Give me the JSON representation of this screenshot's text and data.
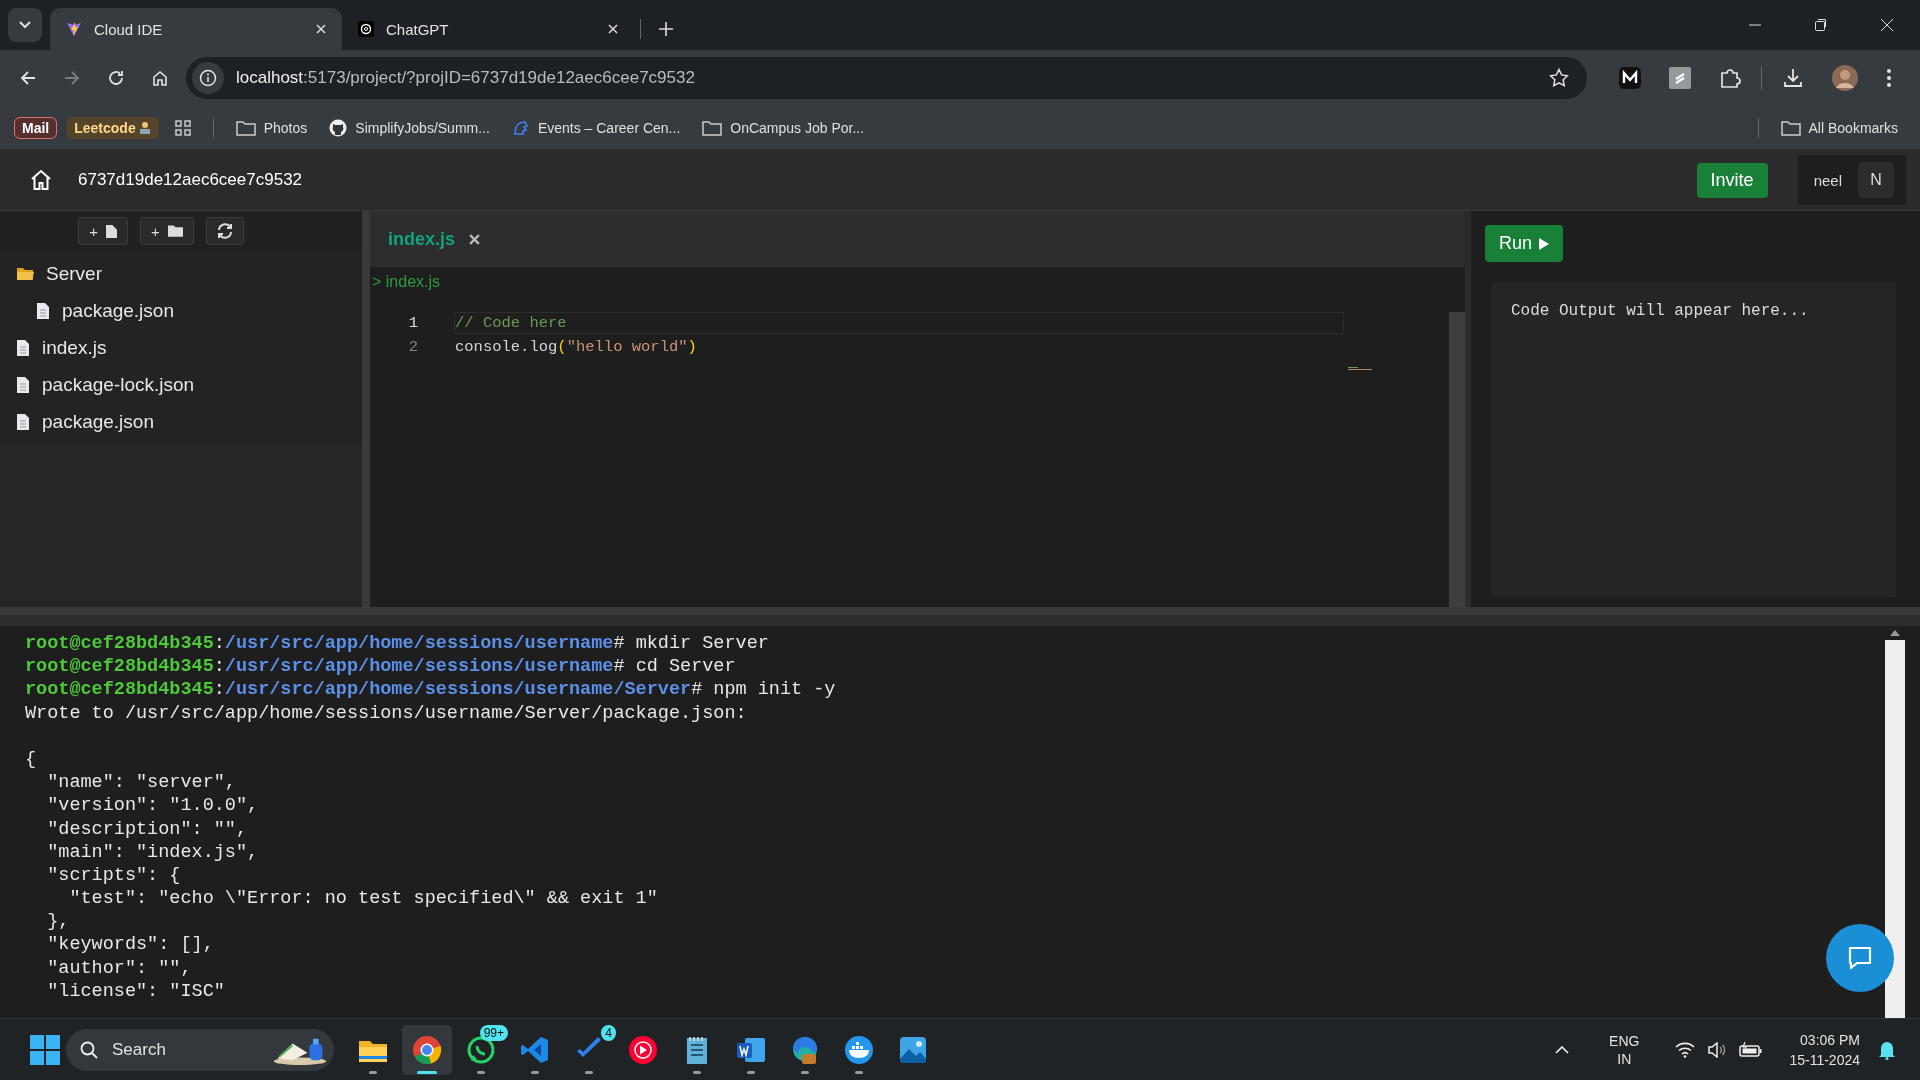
{
  "browser": {
    "tabs": [
      {
        "title": "Cloud IDE",
        "kind": "vite",
        "selected": true
      },
      {
        "title": "ChatGPT",
        "kind": "chatgpt",
        "selected": false
      }
    ],
    "url": {
      "host": "localhost",
      "rest": ":5173/project/?projID=6737d19de12aec6cee7c9532"
    },
    "bookmarks": [
      {
        "label": "Mail",
        "kind": "mail"
      },
      {
        "label": "Leetcode",
        "kind": "leetcode"
      },
      {
        "kind": "apps"
      },
      {
        "label": "Photos",
        "kind": "folder"
      },
      {
        "label": "SimplifyJobs/Summ...",
        "kind": "github"
      },
      {
        "label": "Events – Career Cen...",
        "kind": "events"
      },
      {
        "label": "OnCampus Job Por...",
        "kind": "folder"
      }
    ],
    "all_bookmarks": "All Bookmarks"
  },
  "app": {
    "project_id": "6737d19de12aec6cee7c9532",
    "invite": "Invite",
    "user": {
      "name": "neel",
      "initial": "N"
    },
    "explorer_buttons": [
      {
        "label": "+",
        "kind": "file"
      },
      {
        "label": "+",
        "kind": "folder"
      },
      {
        "kind": "refresh"
      }
    ],
    "tree": [
      {
        "name": "Server",
        "kind": "folder",
        "children": [
          {
            "name": "package.json",
            "kind": "file"
          }
        ]
      },
      {
        "name": "index.js",
        "kind": "file"
      },
      {
        "name": "package-lock.json",
        "kind": "file"
      },
      {
        "name": "package.json",
        "kind": "file"
      }
    ],
    "editor": {
      "tab": "index.js",
      "breadcrumb": "> index.js",
      "lines": [
        {
          "number": "1",
          "current": true,
          "tokens": [
            {
              "text": "// Code here",
              "kind": "comment"
            }
          ]
        },
        {
          "number": "2",
          "current": false,
          "tokens": [
            {
              "text": "console.log",
              "kind": "plain"
            },
            {
              "text": "(",
              "kind": "bracket"
            },
            {
              "text": "\"hello world\"",
              "kind": "string"
            },
            {
              "text": ")",
              "kind": "bracket"
            }
          ]
        }
      ]
    },
    "run": "Run",
    "output_placeholder": "Code Output will appear here...",
    "terminal": [
      {
        "kind": "prompt",
        "user": "root@cef28bd4b345",
        "sep": ":",
        "path": "/usr/src/app/home/sessions/username",
        "command": "# mkdir Server"
      },
      {
        "kind": "prompt",
        "user": "root@cef28bd4b345",
        "sep": ":",
        "path": "/usr/src/app/home/sessions/username",
        "command": "# cd Server"
      },
      {
        "kind": "prompt",
        "user": "root@cef28bd4b345",
        "sep": ":",
        "path": "/usr/src/app/home/sessions/username/Server",
        "command": "# npm init -y"
      },
      {
        "kind": "output",
        "text": "Wrote to /usr/src/app/home/sessions/username/Server/package.json:"
      },
      {
        "kind": "blank"
      },
      {
        "kind": "output",
        "text": "{"
      },
      {
        "kind": "output",
        "text": "  \"name\": \"server\","
      },
      {
        "kind": "output",
        "text": "  \"version\": \"1.0.0\","
      },
      {
        "kind": "output",
        "text": "  \"description\": \"\","
      },
      {
        "kind": "output",
        "text": "  \"main\": \"index.js\","
      },
      {
        "kind": "output",
        "text": "  \"scripts\": {"
      },
      {
        "kind": "output",
        "text": "    \"test\": \"echo \\\"Error: no test specified\\\" && exit 1\""
      },
      {
        "kind": "output",
        "text": "  },"
      },
      {
        "kind": "output",
        "text": "  \"keywords\": [],"
      },
      {
        "kind": "output",
        "text": "  \"author\": \"\","
      },
      {
        "kind": "output",
        "text": "  \"license\": \"ISC\""
      }
    ]
  },
  "taskbar": {
    "search": "Search",
    "apps": [
      {
        "kind": "explorer",
        "running": true,
        "selected": false
      },
      {
        "kind": "chrome",
        "running": true,
        "selected": true
      },
      {
        "kind": "whatsapp",
        "running": true,
        "selected": false,
        "badge": "99+"
      },
      {
        "kind": "vscode",
        "running": true,
        "selected": false
      },
      {
        "kind": "todo",
        "running": true,
        "selected": false,
        "badge": "4"
      },
      {
        "kind": "music",
        "running": false,
        "selected": false
      },
      {
        "kind": "notepad",
        "running": true,
        "selected": false
      },
      {
        "kind": "word",
        "running": true,
        "selected": false
      },
      {
        "kind": "edge",
        "running": true,
        "selected": false
      },
      {
        "kind": "docker",
        "running": true,
        "selected": false
      },
      {
        "kind": "photos",
        "running": false,
        "selected": false
      }
    ],
    "language": "ENG",
    "region": "IN",
    "time": "03:06 PM",
    "date": "15-11-2024"
  }
}
